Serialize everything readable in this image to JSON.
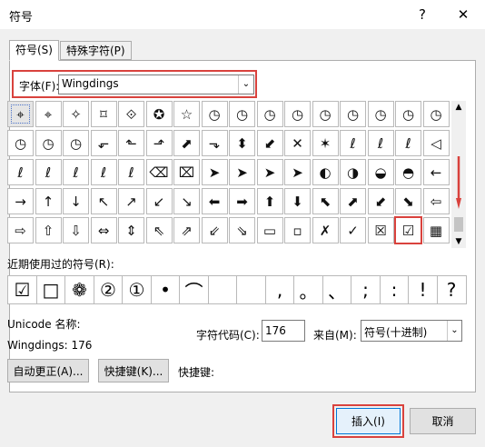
{
  "dialog": {
    "title": "符号",
    "help": "?",
    "close": "✕"
  },
  "tabs": [
    {
      "label": "符号(S)",
      "active": true
    },
    {
      "label": "特殊字符(P)",
      "active": false
    }
  ],
  "font": {
    "label": "字体(F):",
    "value": "Wingdings",
    "arrow": "⌄"
  },
  "symbol_grid": {
    "rows": [
      [
        "⌖",
        "⌖",
        "✧",
        "⌑",
        "⟐",
        "✪",
        "☆",
        "◷",
        "◷",
        "◷",
        "◷",
        "◷",
        "◷",
        "◷",
        "◷",
        "◷"
      ],
      [
        "◷",
        "◷",
        "◷",
        "⬐",
        "⬑",
        "⬏",
        "⬈",
        "⬎",
        "⬍",
        "⬋",
        "✕",
        "✶",
        "ℓ",
        "ℓ",
        "ℓ",
        "◁"
      ],
      [
        "ℓ",
        "ℓ",
        "ℓ",
        "ℓ",
        "ℓ",
        "⌫",
        "⌧",
        "➤",
        "➤",
        "➤",
        "➤",
        "◐",
        "◑",
        "◒",
        "◓",
        "←"
      ],
      [
        "→",
        "↑",
        "↓",
        "↖",
        "↗",
        "↙",
        "↘",
        "⬅",
        "➡",
        "⬆",
        "⬇",
        "⬉",
        "⬈",
        "⬋",
        "⬊",
        "⇦"
      ],
      [
        "⇨",
        "⇧",
        "⇩",
        "⇔",
        "⇕",
        "⇖",
        "⇗",
        "⇙",
        "⇘",
        "▭",
        "▫",
        "✗",
        "✓",
        "☒",
        "☑",
        "▦"
      ]
    ],
    "selected_row": 0,
    "selected_col": 0,
    "highlighted_row": 4,
    "highlighted_col": 14
  },
  "scrollbar": {
    "up": "▲",
    "down": "▼"
  },
  "recent": {
    "label": "近期使用过的符号(R):",
    "symbols": [
      "☑",
      "□",
      "❁",
      "②",
      "①",
      "•",
      "⌒",
      "",
      "",
      ",",
      "。",
      "、",
      ";",
      ":",
      "!",
      "?"
    ]
  },
  "info": {
    "unicode_name_label": "Unicode 名称:",
    "font_code": "Wingdings: 176",
    "char_code_label": "字符代码(C):",
    "char_code_value": "176",
    "from_label": "来自(M):",
    "from_value": "符号(十进制)",
    "from_arrow": "⌄"
  },
  "buttons": {
    "autocorrect": "自动更正(A)...",
    "shortcut_key": "快捷键(K)...",
    "shortcut_label": "快捷键:",
    "insert": "插入(I)",
    "cancel": "取消"
  },
  "colors": {
    "highlight_red": "#d9423d",
    "focus_blue": "#0078d7"
  }
}
